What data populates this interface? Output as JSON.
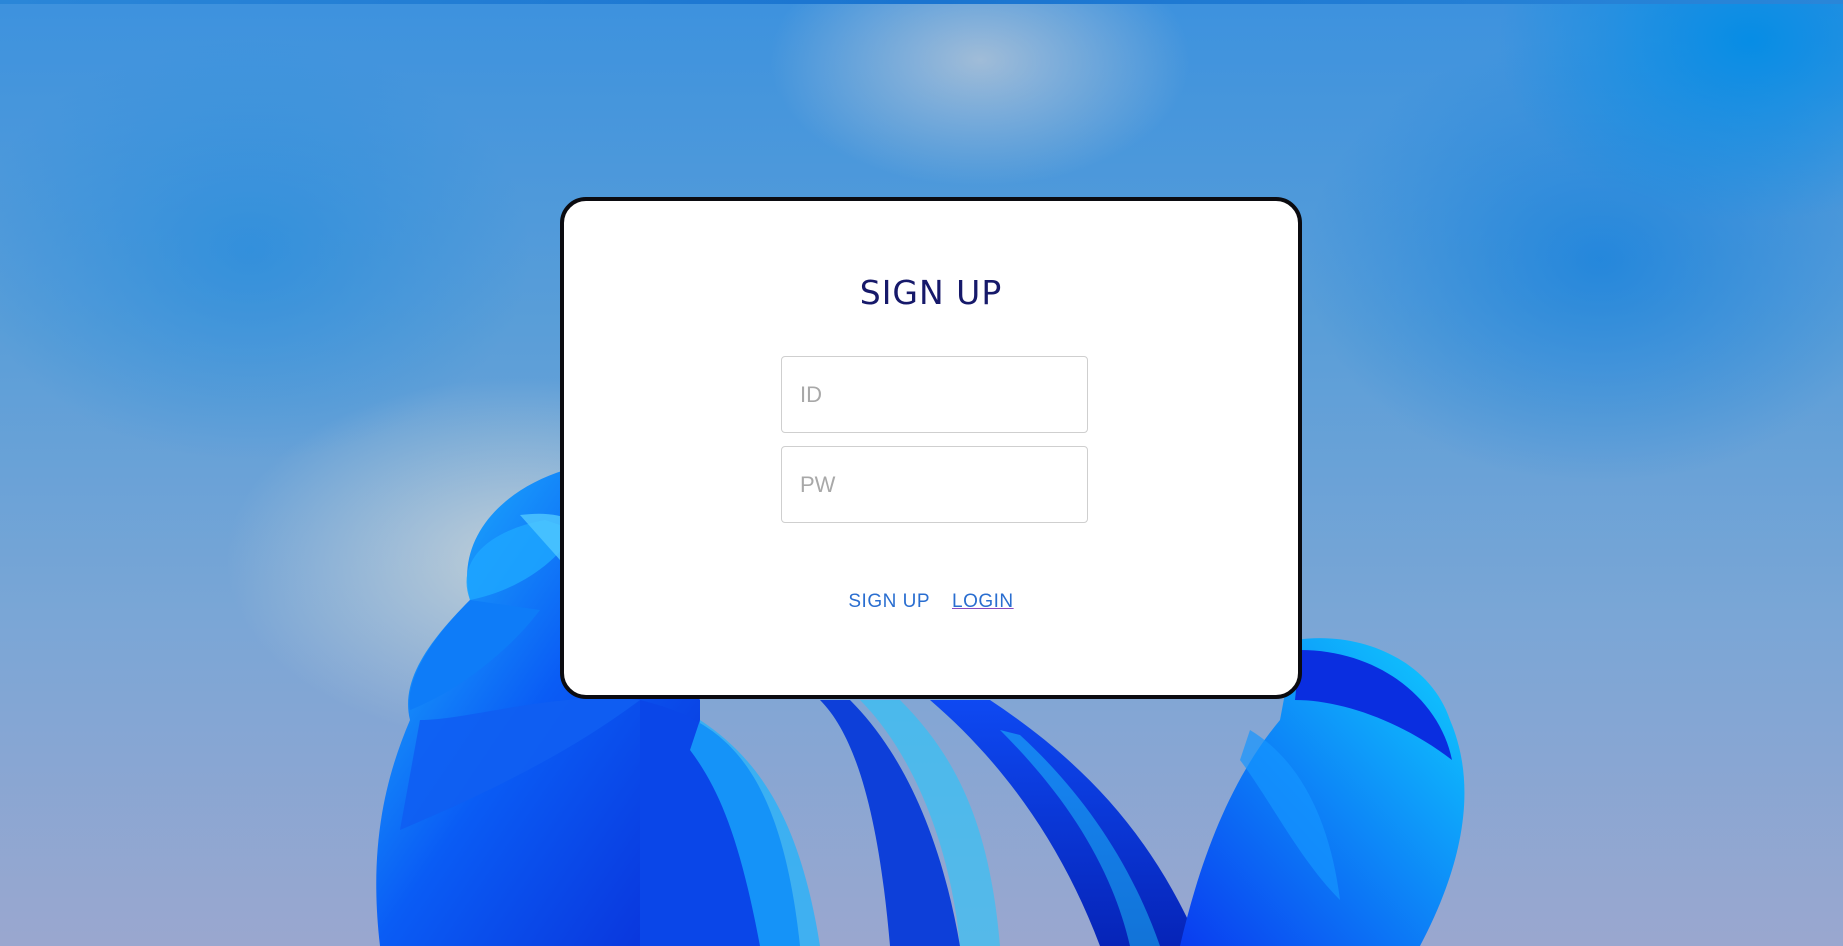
{
  "page": {
    "background_colors": {
      "sky_top": "#3d92de",
      "sky_bottom": "#9aa7cf",
      "bloom_primary": "#0a3cf0",
      "bloom_highlight": "#19b4ff"
    }
  },
  "card": {
    "title": "SIGN UP",
    "id_field": {
      "value": "",
      "placeholder": "ID"
    },
    "pw_field": {
      "value": "",
      "placeholder": "PW"
    },
    "signup_button_label": "SIGN UP",
    "login_link_label": "LOGIN",
    "colors": {
      "title": "#16196a",
      "action_text": "#2a6ed0",
      "border": "#0b0b10"
    }
  }
}
